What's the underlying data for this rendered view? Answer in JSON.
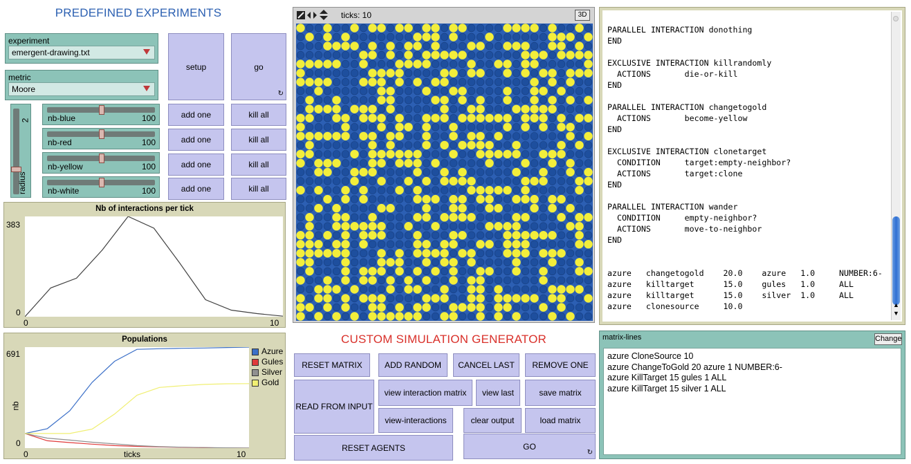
{
  "left_panel": {
    "title": "PREDEFINED EXPERIMENTS",
    "experiment_chooser": {
      "label": "experiment",
      "value": "emergent-drawing.txt"
    },
    "metric_chooser": {
      "label": "metric",
      "value": "Moore"
    },
    "setup_label": "setup",
    "go_label": "go",
    "radius_slider": {
      "label": "radius",
      "value": "2",
      "fraction": 0.28
    },
    "sliders": [
      {
        "label": "nb-blue",
        "value": "100",
        "fraction": 0.5
      },
      {
        "label": "nb-red",
        "value": "100",
        "fraction": 0.5
      },
      {
        "label": "nb-yellow",
        "value": "100",
        "fraction": 0.5
      },
      {
        "label": "nb-white",
        "value": "100",
        "fraction": 0.5
      }
    ],
    "add_one_labels": [
      "add one",
      "add one",
      "add one",
      "add one"
    ],
    "kill_all_labels": [
      "kill all",
      "kill all",
      "kill all",
      "kill all"
    ]
  },
  "plot_interactions": {
    "title": "Nb of interactions per tick",
    "ymax_label": "383",
    "ymin_label": "0",
    "xmin_label": "0",
    "xmax_label": "10",
    "chart_data": {
      "type": "line",
      "title": "Nb of interactions per tick",
      "x": [
        0,
        1,
        2,
        3,
        4,
        5,
        6,
        7,
        8,
        9,
        10
      ],
      "series": [
        {
          "values": [
            0,
            110,
            147,
            255,
            383,
            338,
            205,
            65,
            25,
            12,
            2
          ],
          "color": "#404040"
        }
      ],
      "xlim": [
        0,
        10
      ],
      "ylim": [
        0,
        383
      ]
    }
  },
  "plot_populations": {
    "title": "Populations",
    "ymax_label": "691",
    "ymin_label": "0",
    "xmin_label": "0",
    "xmax_label": "10",
    "xlabel": "ticks",
    "ylabel": "nb",
    "chart_data": {
      "type": "line",
      "title": "Populations",
      "xlabel": "ticks",
      "ylabel": "nb",
      "x": [
        0,
        1,
        2,
        3,
        4,
        5,
        6,
        7,
        8,
        9,
        10
      ],
      "series": [
        {
          "name": "Azure",
          "color": "#3c70c8",
          "values": [
            100,
            133,
            255,
            450,
            594,
            676,
            680,
            683,
            685,
            688,
            691
          ]
        },
        {
          "name": "Gules",
          "color": "#e03a3a",
          "values": [
            100,
            50,
            38,
            27,
            17,
            12,
            8,
            5,
            3,
            1,
            0
          ]
        },
        {
          "name": "Silver",
          "color": "#909090",
          "values": [
            100,
            68,
            55,
            40,
            29,
            17,
            10,
            6,
            4,
            2,
            1
          ]
        },
        {
          "name": "Gold",
          "color": "#f0ef72",
          "values": [
            100,
            100,
            100,
            130,
            233,
            362,
            415,
            427,
            436,
            440,
            441
          ]
        }
      ],
      "xlim": [
        0,
        10
      ],
      "ylim": [
        0,
        691
      ],
      "legend": "right"
    }
  },
  "view": {
    "ticks_text": "ticks: 10",
    "btn_3d": "3D",
    "grid_seed": 10
  },
  "custom": {
    "title": "CUSTOM SIMULATION GENERATOR",
    "reset_matrix": "RESET MATRIX",
    "add_random": "ADD RANDOM",
    "cancel_last": "CANCEL LAST",
    "remove_one": "REMOVE ONE",
    "read_from_input": "READ FROM INPUT",
    "view_interaction_matrix": "view interaction matrix",
    "view_last": "view last",
    "save_matrix": "save matrix",
    "view_interactions": "view-interactions",
    "clear_output": "clear output",
    "load_matrix": "load matrix",
    "reset_agents": "RESET AGENTS",
    "go": "GO"
  },
  "output": {
    "text": "PARALLEL INTERACTION donothing\nEND\n\nEXCLUSIVE INTERACTION killrandomly\n  ACTIONS       die-or-kill\nEND\n\nPARALLEL INTERACTION changetogold\n  ACTIONS       become-yellow\nEND\n\nEXCLUSIVE INTERACTION clonetarget\n  CONDITION     target:empty-neighbor?\n  ACTIONS       target:clone\nEND\n\nPARALLEL INTERACTION wander\n  CONDITION     empty-neighbor?\n  ACTIONS       move-to-neighbor\nEND\n\n\nazure   changetogold    20.0    azure   1.0     NUMBER:6-\nazure   killtarget      15.0    gules   1.0     ALL\nazure   killtarget      15.0    silver  1.0     ALL\nazure   clonesource     10.0"
  },
  "matrix_lines": {
    "label": "matrix-lines",
    "change": "Change",
    "text": "azure CloneSource 10\nazure ChangeToGold 20 azure 1 NUMBER:6-\nazure KillTarget 15 gules 1 ALL\nazure KillTarget 15 silver 1 ALL"
  },
  "colors": {
    "patch_blue": "#2c5fb3",
    "gold": "#f3ee3b",
    "button": "#c5c5ee",
    "widget": "#8cc3b8",
    "plot_bg": "#d8d8b8"
  }
}
